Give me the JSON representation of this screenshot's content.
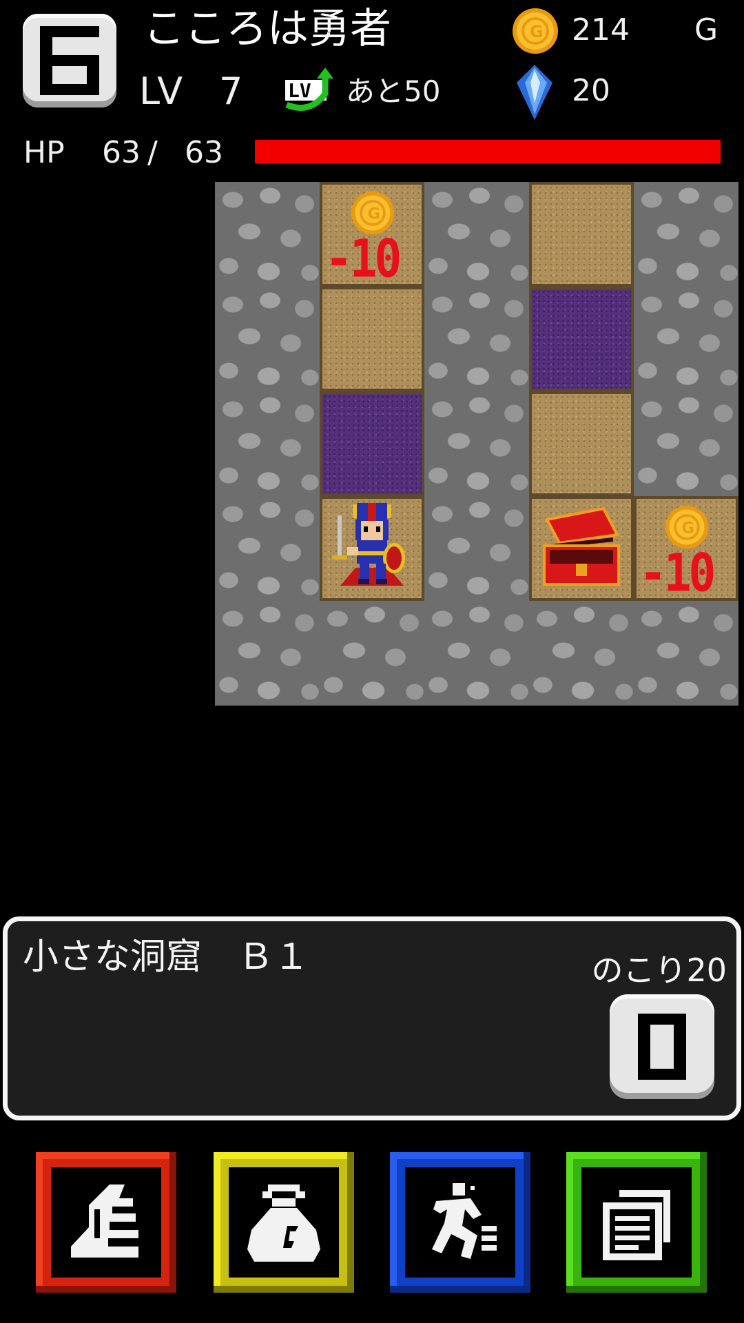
{
  "header": {
    "floor_badge": "6",
    "hero_name": "こころは勇者",
    "level_label": "LV",
    "level": "7",
    "exp_remaining": "あと50",
    "gold": "214",
    "gold_unit": "G",
    "gems": "20",
    "hp_label": "HP",
    "hp_current": "63",
    "hp_separator": "/",
    "hp_max": "63",
    "hp_fraction": 1.0
  },
  "dungeon": {
    "tile_damage_top": "-10",
    "tile_damage_right": "-10"
  },
  "message_panel": {
    "area_name": "小さな洞窟　Ｂ１",
    "remaining_label": "のこり20"
  },
  "commands": {
    "magic": "magic",
    "items": "items",
    "escape": "escape",
    "log": "log"
  },
  "colors": {
    "hp_bar": "#f20000",
    "magic_button": "#d42410",
    "items_button": "#c8c010",
    "escape_button": "#1040c8",
    "log_button": "#38b40c"
  },
  "icons": {
    "floor_badge": "pixel-digit-badge-icon",
    "level_up": "level-up-arrow-icon",
    "currency": "gold-coin-icon",
    "gem": "crystal-gem-icon",
    "hero": "pixel-knight-hero-icon",
    "chest": "open-treasure-chest-icon",
    "magic": "wing-feather-icon",
    "items": "money-bag-icon",
    "escape": "running-man-icon",
    "log": "documents-icon",
    "stop": "pause-block-icon"
  }
}
